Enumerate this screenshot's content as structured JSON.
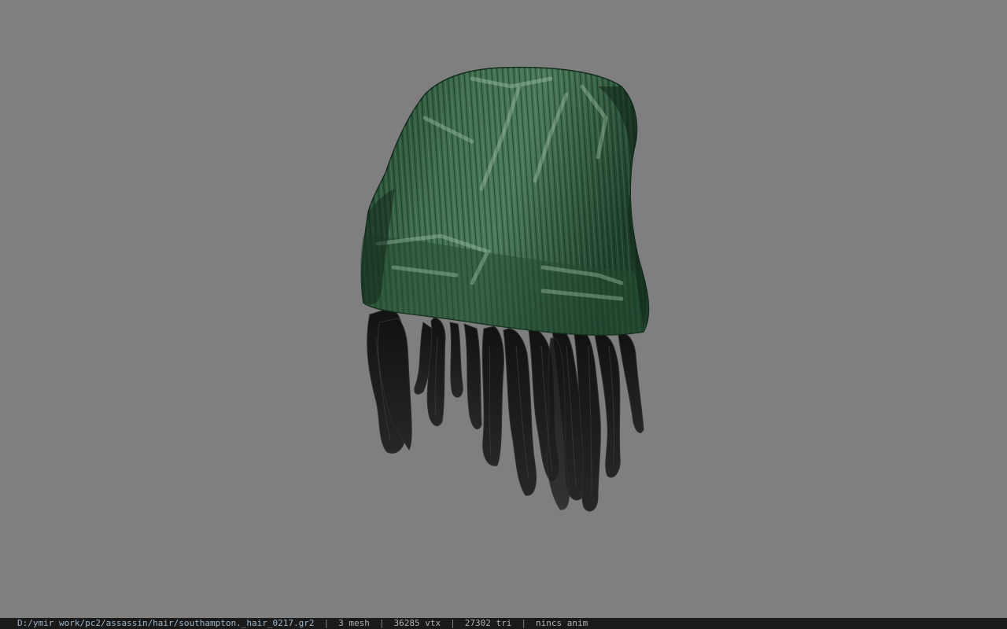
{
  "viewer": {
    "background_color": "#7f7f7f",
    "model": {
      "hat_color": "#2e5a3a",
      "hat_shadow_color": "#173523",
      "hat_highlight_color": "#6f9a7c",
      "hair_color": "#1b1b1b",
      "hair_highlight_color": "#3a3a3a"
    }
  },
  "status_bar": {
    "file_path": "D:/ymir work/pc2/assassin/hair/southampton._hair_0217.gr2",
    "mesh_count": "3 mesh",
    "vertex_count": "36285 vtx",
    "triangle_count": "27302 tri",
    "animation": "nincs anim",
    "separator": "|"
  }
}
